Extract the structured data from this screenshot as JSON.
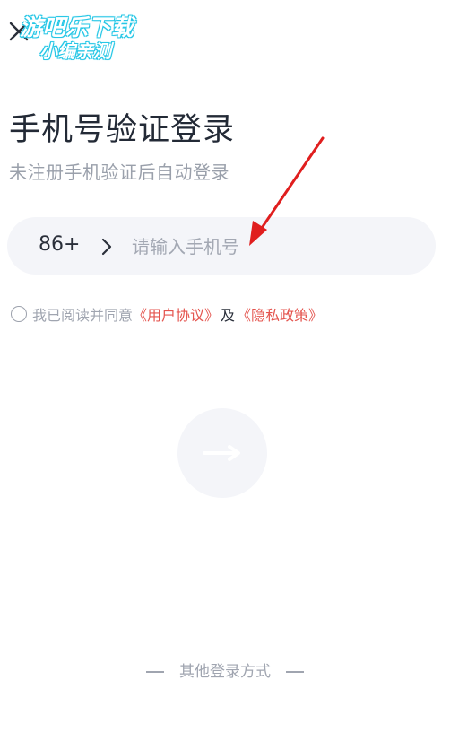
{
  "watermark": {
    "line1": "游吧乐下载",
    "line2": "小编亲测"
  },
  "header": {
    "title": "手机号验证登录",
    "subtitle": "未注册手机验证后自动登录"
  },
  "phone": {
    "country_code": "86+",
    "placeholder": "请输入手机号",
    "value": ""
  },
  "agreement": {
    "prefix": "我已阅读并同意",
    "user_agreement": "《用户协议》",
    "conjunction": "及",
    "privacy_policy": "《隐私政策》"
  },
  "other_login": {
    "label": "其他登录方式"
  },
  "colors": {
    "accent_link": "#e4554f",
    "input_bg": "#f4f5f9",
    "annotation_arrow": "#e01e1e",
    "watermark_outline": "#27c7e6"
  },
  "icons": {
    "close": "close-icon",
    "chevron": "chevron-right-icon",
    "submit": "arrow-right-icon"
  }
}
